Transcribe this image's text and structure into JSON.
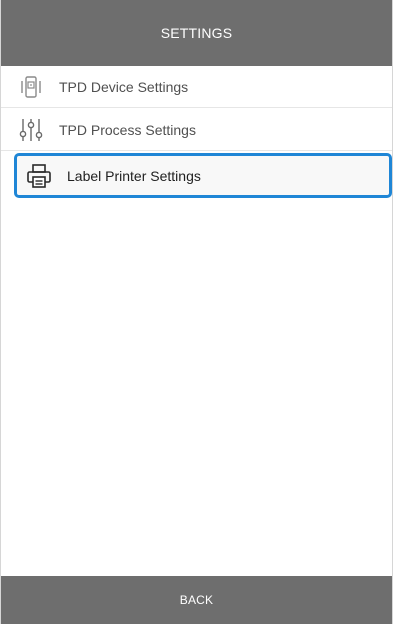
{
  "header": {
    "title": "SETTINGS"
  },
  "menu": {
    "items": [
      {
        "label": "TPD Device Settings",
        "icon": "tablet-icon"
      },
      {
        "label": "TPD Process Settings",
        "icon": "sliders-icon"
      },
      {
        "label": "Label Printer Settings",
        "icon": "printer-icon",
        "selected": true
      }
    ]
  },
  "footer": {
    "back_label": "BACK"
  },
  "colors": {
    "bar": "#6e6e6e",
    "selection_border": "#1f86d6"
  }
}
